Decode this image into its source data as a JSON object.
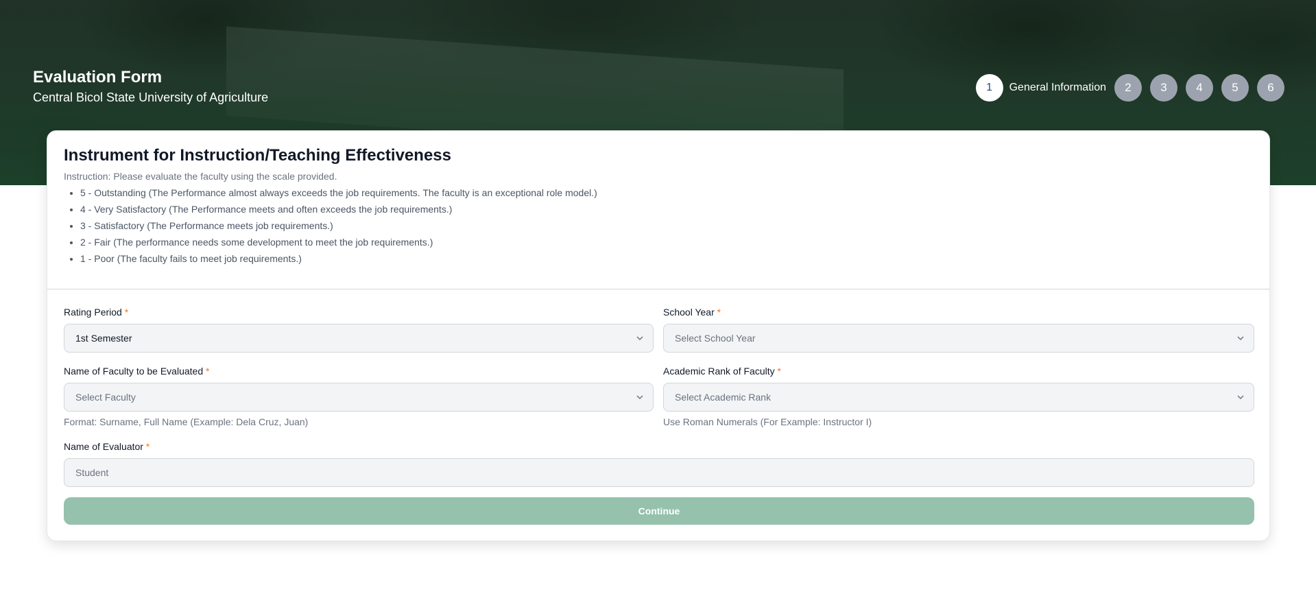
{
  "header": {
    "title": "Evaluation Form",
    "subtitle": "Central Bicol State University of Agriculture"
  },
  "stepper": {
    "active_step": "1",
    "active_label": "General Information",
    "steps": [
      "2",
      "3",
      "4",
      "5",
      "6"
    ]
  },
  "card": {
    "title": "Instrument for Instruction/Teaching Effectiveness",
    "instruction": "Instruction: Please evaluate the faculty using the scale provided.",
    "scale": [
      "5 - Outstanding (The Performance almost always exceeds the job requirements. The faculty is an exceptional role model.)",
      "4 - Very Satisfactory (The Performance meets and often exceeds the job requirements.)",
      "3 - Satisfactory (The Performance meets job requirements.)",
      "2 - Fair (The performance needs some development to meet the job requirements.)",
      "1 - Poor (The faculty fails to meet job requirements.)"
    ]
  },
  "form": {
    "required_mark": "*",
    "rating_period": {
      "label": "Rating Period",
      "value": "1st Semester"
    },
    "school_year": {
      "label": "School Year",
      "placeholder": "Select School Year"
    },
    "faculty_name": {
      "label": "Name of Faculty to be Evaluated",
      "placeholder": "Select Faculty",
      "help": "Format: Surname, Full Name (Example: Dela Cruz, Juan)"
    },
    "academic_rank": {
      "label": "Academic Rank of Faculty",
      "placeholder": "Select Academic Rank",
      "help": "Use Roman Numerals (For Example: Instructor I)"
    },
    "evaluator": {
      "label": "Name of Evaluator",
      "placeholder": "Student"
    },
    "continue_label": "Continue"
  },
  "colors": {
    "required": "#f97316",
    "continue_button": "#95c1ad",
    "step_inactive": "#9ca3af"
  }
}
